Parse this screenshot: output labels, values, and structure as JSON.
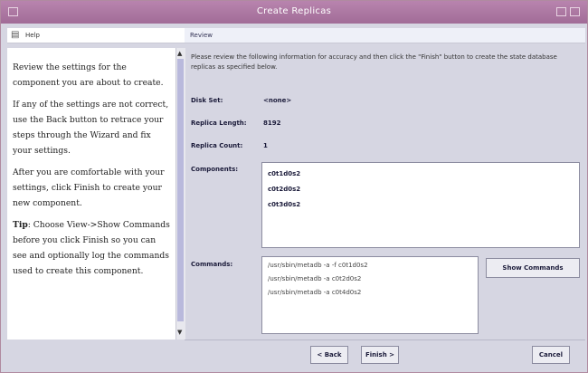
{
  "window": {
    "title": "Create Replicas"
  },
  "help": {
    "header": "Help",
    "paragraphs": [
      "Review the settings for the component you are about to create.",
      "If any of the settings are not correct, use the Back button to retrace your steps through the Wizard and fix your settings.",
      "After you are comfortable with your settings, click Finish to create your new component."
    ],
    "tip_label": "Tip",
    "tip_text": ": Choose View->Show Commands before you click Finish so you can see and optionally log the commands used to create this component."
  },
  "main": {
    "header": "Review",
    "intro": "Please review the following information for accuracy and then click the \"Finish\" button to create the state database replicas as specified below.",
    "fields": {
      "disk_set": {
        "label": "Disk Set:",
        "value": "<none>"
      },
      "replica_length": {
        "label": "Replica Length:",
        "value": "8192"
      },
      "replica_count": {
        "label": "Replica Count:",
        "value": "1"
      },
      "components": {
        "label": "Components:",
        "items": [
          "c0t1d0s2",
          "c0t2d0s2",
          "c0t3d0s2"
        ]
      },
      "commands": {
        "label": "Commands:",
        "items": [
          "/usr/sbin/metadb -a -f c0t1d0s2",
          "/usr/sbin/metadb -a c0t2d0s2",
          "/usr/sbin/metadb -a c0t4d0s2"
        ]
      }
    },
    "show_commands_label": "Show Commands"
  },
  "footer": {
    "back_label": "< Back",
    "finish_label": "Finish >",
    "cancel_label": "Cancel"
  }
}
